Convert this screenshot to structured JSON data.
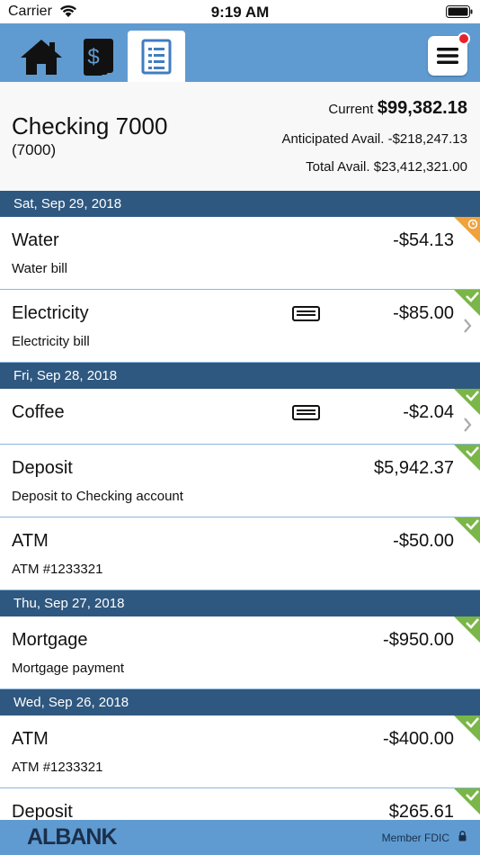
{
  "status_bar": {
    "carrier": "Carrier",
    "time": "9:19 AM"
  },
  "nav": {
    "tabs": [
      {
        "icon": "home-icon"
      },
      {
        "icon": "dollar-cards-icon"
      },
      {
        "icon": "register-icon",
        "active": true
      }
    ],
    "menu_icon": "hamburger-menu-icon"
  },
  "account": {
    "name": "Checking 7000",
    "number": "(7000)",
    "current_label": "Current",
    "current_value": "$99,382.18",
    "anticipated": "Anticipated Avail. -$218,247.13",
    "total": "Total Avail. $23,412,321.00"
  },
  "dates": [
    "Sat, Sep 29, 2018",
    "Fri, Sep 28, 2018",
    "Thu, Sep 27, 2018",
    "Wed, Sep 26, 2018"
  ],
  "transactions": [
    {
      "title": "Water",
      "desc": "Water bill",
      "amount": "-$54.13",
      "status": "pending"
    },
    {
      "title": "Electricity",
      "desc": "Electricity bill",
      "amount": "-$85.00",
      "status": "cleared"
    },
    {
      "title": "Coffee",
      "desc": "",
      "amount": "-$2.04",
      "status": "cleared"
    },
    {
      "title": "Deposit",
      "desc": "Deposit to Checking account",
      "amount": "$5,942.37",
      "status": "cleared"
    },
    {
      "title": "ATM",
      "desc": "ATM #1233321",
      "amount": "-$50.00",
      "status": "cleared"
    },
    {
      "title": "Mortgage",
      "desc": "Mortgage payment",
      "amount": "-$950.00",
      "status": "cleared"
    },
    {
      "title": "ATM",
      "desc": "ATM #1233321",
      "amount": "-$400.00",
      "status": "cleared"
    },
    {
      "title": "Deposit",
      "desc": "",
      "amount": "$265.61",
      "status": "cleared"
    }
  ],
  "footer": {
    "logo": "ALBANK",
    "fdic": "Member FDIC"
  },
  "colors": {
    "nav": "#5f9bd1",
    "date_header": "#2f5880",
    "cleared": "#7ab648",
    "pending": "#f0a23b"
  }
}
